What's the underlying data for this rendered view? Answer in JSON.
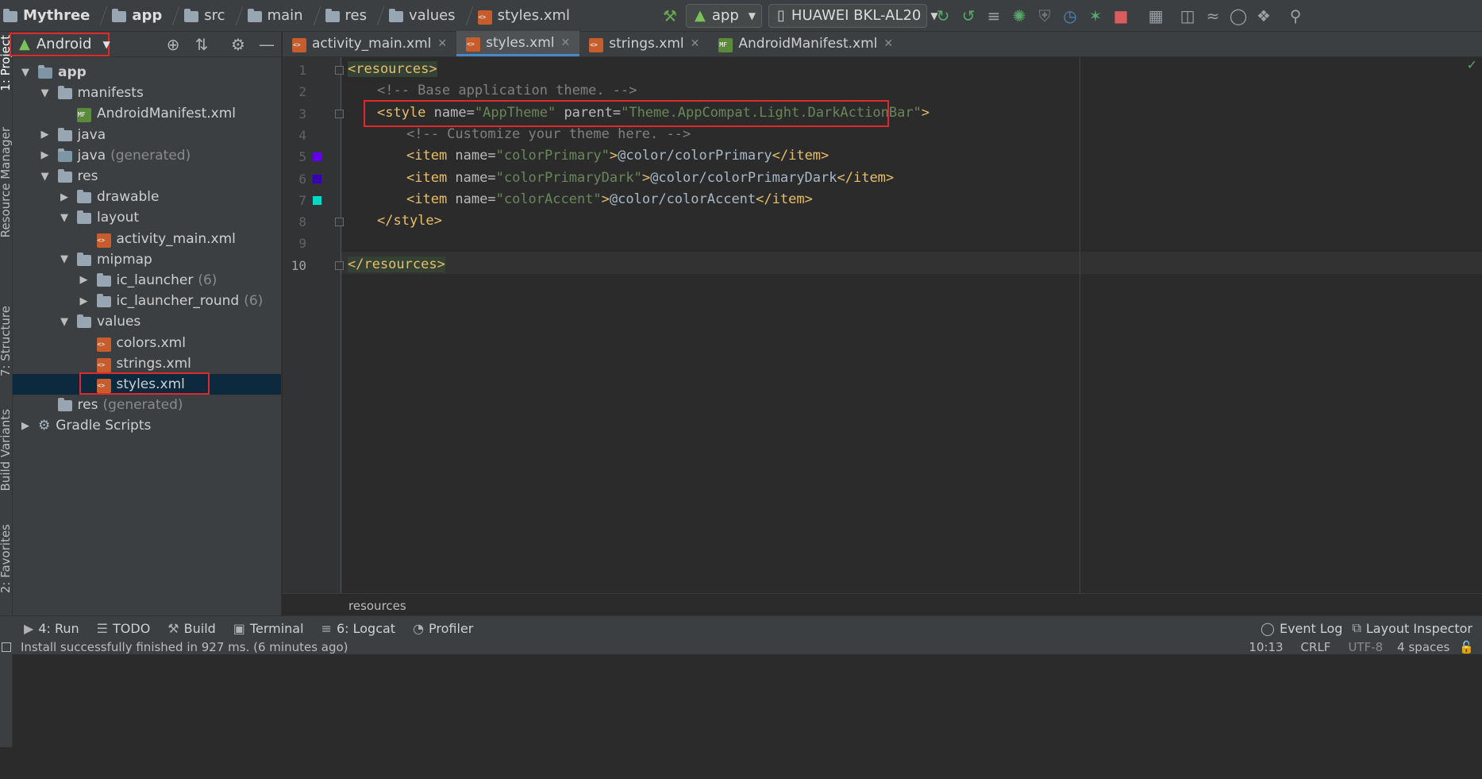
{
  "breadcrumbs": [
    {
      "label": "Mythree",
      "icon": "project-icon"
    },
    {
      "label": "app",
      "icon": "module-folder-icon"
    },
    {
      "label": "src",
      "icon": "folder-icon"
    },
    {
      "label": "main",
      "icon": "folder-icon"
    },
    {
      "label": "res",
      "icon": "folder-icon"
    },
    {
      "label": "values",
      "icon": "folder-icon"
    },
    {
      "label": "styles.xml",
      "icon": "xml-file-icon"
    }
  ],
  "toolbar": {
    "run_config": "app",
    "device": "HUAWEI BKL-AL20"
  },
  "sidebar_tabs": {
    "project": "1: Project",
    "resource_manager": "Resource Manager",
    "structure": "7: Structure",
    "build_variants": "Build Variants",
    "favorites": "2: Favorites"
  },
  "project_panel": {
    "view_mode": "Android"
  },
  "tree": [
    {
      "label": "app",
      "depth": 0,
      "arrow": "▼",
      "icon": "module-folder-icon",
      "bold": true
    },
    {
      "label": "manifests",
      "depth": 1,
      "arrow": "▼",
      "icon": "folder-icon"
    },
    {
      "label": "AndroidManifest.xml",
      "depth": 2,
      "arrow": "",
      "icon": "manifest-file-icon"
    },
    {
      "label": "java",
      "depth": 1,
      "arrow": "▶",
      "icon": "folder-icon"
    },
    {
      "label": "java",
      "suffix": "(generated)",
      "depth": 1,
      "arrow": "▶",
      "icon": "generated-folder-icon"
    },
    {
      "label": "res",
      "depth": 1,
      "arrow": "▼",
      "icon": "resource-folder-icon"
    },
    {
      "label": "drawable",
      "depth": 2,
      "arrow": "▶",
      "icon": "folder-icon"
    },
    {
      "label": "layout",
      "depth": 2,
      "arrow": "▼",
      "icon": "folder-icon"
    },
    {
      "label": "activity_main.xml",
      "depth": 3,
      "arrow": "",
      "icon": "xml-file-icon"
    },
    {
      "label": "mipmap",
      "depth": 2,
      "arrow": "▼",
      "icon": "folder-icon"
    },
    {
      "label": "ic_launcher",
      "suffix": "(6)",
      "depth": 3,
      "arrow": "▶",
      "icon": "folder-icon"
    },
    {
      "label": "ic_launcher_round",
      "suffix": "(6)",
      "depth": 3,
      "arrow": "▶",
      "icon": "folder-icon"
    },
    {
      "label": "values",
      "depth": 2,
      "arrow": "▼",
      "icon": "folder-icon"
    },
    {
      "label": "colors.xml",
      "depth": 3,
      "arrow": "",
      "icon": "xml-file-icon"
    },
    {
      "label": "strings.xml",
      "depth": 3,
      "arrow": "",
      "icon": "xml-file-icon"
    },
    {
      "label": "styles.xml",
      "depth": 3,
      "arrow": "",
      "icon": "xml-file-icon",
      "selected": true
    },
    {
      "label": "res",
      "suffix": "(generated)",
      "depth": 1,
      "arrow": "",
      "icon": "resource-folder-icon"
    },
    {
      "label": "Gradle Scripts",
      "depth": 0,
      "arrow": "▶",
      "icon": "gradle-icon"
    }
  ],
  "tabs": [
    {
      "label": "activity_main.xml",
      "icon": "xml-file-icon",
      "active": false
    },
    {
      "label": "styles.xml",
      "icon": "xml-file-icon",
      "active": true
    },
    {
      "label": "strings.xml",
      "icon": "xml-file-icon",
      "active": false
    },
    {
      "label": "AndroidManifest.xml",
      "icon": "manifest-file-icon",
      "active": false
    }
  ],
  "code_lines": [
    {
      "n": "1",
      "html": [
        [
          "tag",
          "<resources>"
        ]
      ],
      "indent": 0,
      "hl": true
    },
    {
      "n": "2",
      "html": [
        [
          "cmt",
          "<!-- Base application theme. -->"
        ]
      ],
      "indent": 1
    },
    {
      "n": "3",
      "html": [
        [
          "tag",
          "<style "
        ],
        [
          "attr",
          "name="
        ],
        [
          "val",
          "\"AppTheme\""
        ],
        [
          "attr",
          " parent="
        ],
        [
          "val",
          "\"Theme.AppCompat.Light.DarkActionBar\""
        ],
        [
          "tag",
          ">"
        ]
      ],
      "indent": 1
    },
    {
      "n": "4",
      "html": [
        [
          "cmt",
          "<!-- Customize your theme here. -->"
        ]
      ],
      "indent": 2
    },
    {
      "n": "5",
      "html": [
        [
          "tag",
          "<item "
        ],
        [
          "attr",
          "name="
        ],
        [
          "val",
          "\"colorPrimary\""
        ],
        [
          "tag",
          ">"
        ],
        [
          "txt",
          "@color/colorPrimary"
        ],
        [
          "tag",
          "</item>"
        ]
      ],
      "indent": 2
    },
    {
      "n": "6",
      "html": [
        [
          "tag",
          "<item "
        ],
        [
          "attr",
          "name="
        ],
        [
          "val",
          "\"colorPrimaryDark\""
        ],
        [
          "tag",
          ">"
        ],
        [
          "txt",
          "@color/colorPrimaryDark"
        ],
        [
          "tag",
          "</item>"
        ]
      ],
      "indent": 2
    },
    {
      "n": "7",
      "html": [
        [
          "tag",
          "<item "
        ],
        [
          "attr",
          "name="
        ],
        [
          "val",
          "\"colorAccent\""
        ],
        [
          "tag",
          ">"
        ],
        [
          "txt",
          "@color/colorAccent"
        ],
        [
          "tag",
          "</item>"
        ]
      ],
      "indent": 2
    },
    {
      "n": "8",
      "html": [
        [
          "tag",
          "</style>"
        ]
      ],
      "indent": 1
    },
    {
      "n": "9",
      "html": [],
      "indent": 0
    },
    {
      "n": "10",
      "html": [
        [
          "tag",
          "</resources>"
        ]
      ],
      "indent": 0,
      "hl": true
    }
  ],
  "swatches": {
    "colorPrimary": "#6200EE",
    "colorPrimaryDark": "#3700B3",
    "colorAccent": "#03DAC5"
  },
  "editor_breadcrumb": "resources",
  "bottom_tools": [
    {
      "label": "4: Run",
      "icon": "run-icon"
    },
    {
      "label": "TODO",
      "icon": "todo-icon"
    },
    {
      "label": "Build",
      "icon": "build-icon"
    },
    {
      "label": "Terminal",
      "icon": "terminal-icon"
    },
    {
      "label": "6: Logcat",
      "icon": "logcat-icon"
    },
    {
      "label": "Profiler",
      "icon": "profiler-icon"
    }
  ],
  "bottom_right_tools": [
    {
      "label": "Event Log",
      "icon": "event-log-icon"
    },
    {
      "label": "Layout Inspector",
      "icon": "layout-inspector-icon"
    }
  ],
  "status": {
    "message": "Install successfully finished in 927 ms. (6 minutes ago)",
    "position": "10:13",
    "line_sep": "CRLF",
    "encoding": "UTF-8",
    "indent": "4 spaces"
  },
  "colors": {
    "accent": "#4a88c7",
    "highlight_box": "#e0292b"
  }
}
